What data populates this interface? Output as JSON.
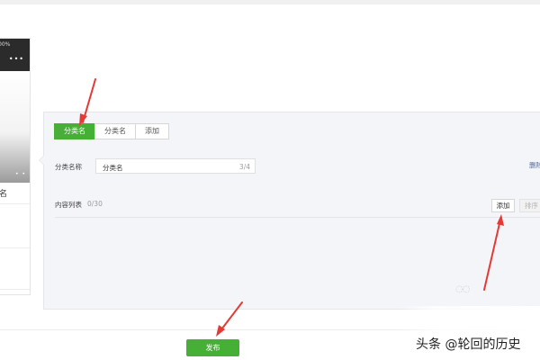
{
  "phone": {
    "battery": "00%",
    "menu_dots": "•••",
    "image_dots": "• •",
    "tab_label": "名"
  },
  "tabs": [
    {
      "label": "分类名",
      "active": true
    },
    {
      "label": "分类名",
      "active": false
    },
    {
      "label": "添加",
      "active": false
    }
  ],
  "form": {
    "name_label": "分类名称",
    "name_value": "分类名",
    "name_count": "3/4",
    "delete_label": "删除",
    "list_label": "内容列表",
    "list_count": "0/30",
    "add_label": "添加",
    "sort_label": "排序"
  },
  "footer": {
    "publish_label": "发布"
  },
  "watermark": "头条 @轮回的历史",
  "colors": {
    "accent": "#45b035",
    "annotation_arrow": "#e53935",
    "panel_bg": "#f4f5f9"
  }
}
